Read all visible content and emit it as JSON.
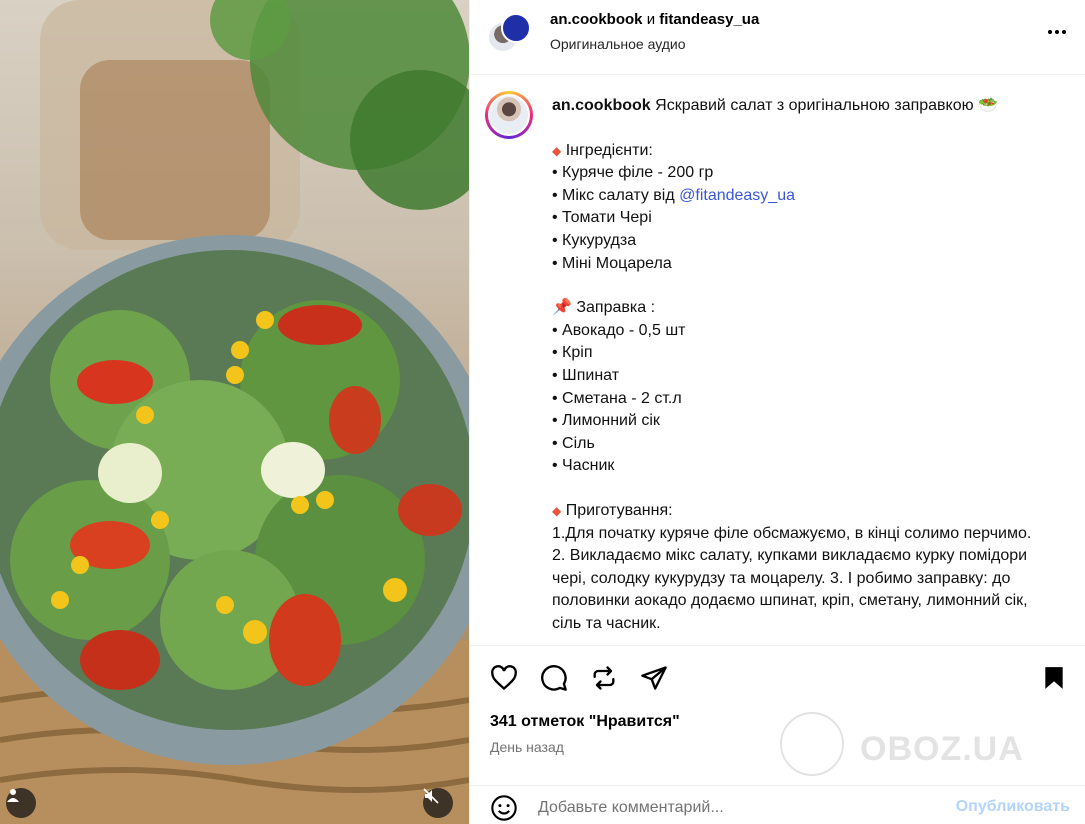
{
  "header": {
    "user1": "an.cookbook",
    "conjunction": "и",
    "user2": "fitandeasy_ua",
    "audio": "Оригинальное аудио"
  },
  "caption": {
    "username": "an.cookbook",
    "headline": "Яскравий салат з оригінальною заправкою 🥗",
    "ingredients_title": "Інгредієнти:",
    "ingredients": [
      "• Куряче філе - 200 гр",
      "• Мікс салату від ",
      "• Томати Чері",
      "• Кукурудза",
      "• Міні Моцарела"
    ],
    "mention": "@fitandeasy_ua",
    "dressing_title": "📌 Заправка :",
    "dressing": [
      "• Авокадо - 0,5 шт",
      "• Кріп",
      "• Шпинат",
      "• Сметана - 2 ст.л",
      "• Лимонний сік",
      "• Сіль",
      "• Часник"
    ],
    "prep_title": "Приготування:",
    "prep_text": "1.Для початку куряче філе обсмажуємо, в кінці солимо перчимо.\n2. Викладаємо мікс салату, купками викладаємо курку помідори чері, солодку кукурудзу та моцарелу. 3. І робимо заправку: до половинки аокадо додаємо шпинат, кріп, сметану, лимонний сік, сіль та часник."
  },
  "stats": {
    "likes": "341 отметок \"Нравится\"",
    "posted": "День назад"
  },
  "comment": {
    "placeholder": "Добавьте комментарий...",
    "publish": "Опубликовать"
  },
  "watermark": "OBOZ.UA",
  "icons": {
    "like": "heart-icon",
    "comment": "comment-icon",
    "repost": "repost-icon",
    "share": "send-icon",
    "save": "bookmark-icon",
    "emoji": "emoji-icon",
    "more": "more-icon",
    "user": "user-tag-icon",
    "mute": "muted-speaker-icon"
  },
  "colors": {
    "mention": "#3c56d8",
    "publish": "#b3d4fc"
  }
}
